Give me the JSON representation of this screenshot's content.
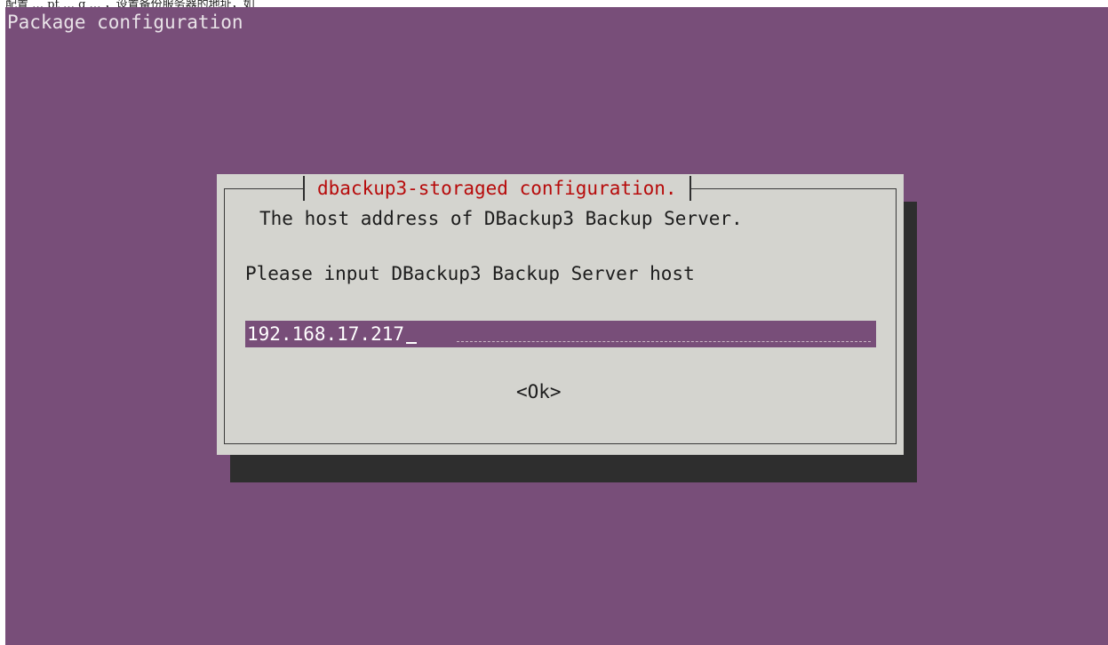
{
  "document": {
    "caption": "配置 … pt … g … ，设置备份服务器的地址，如"
  },
  "terminal": {
    "title": "Package configuration"
  },
  "dialog": {
    "title": "dbackup3-storaged configuration.",
    "subtitle": "The host address of DBackup3 Backup Server.",
    "prompt": "Please input DBackup3 Backup Server host",
    "input_value": "192.168.17.217",
    "ok_label": "<Ok>"
  },
  "colors": {
    "terminal_bg": "#784e79",
    "terminal_text": "#e9e3e8",
    "dialog_bg": "#d4d4cf",
    "dialog_title": "#b70b0b",
    "shadow": "#2e2e2e"
  }
}
